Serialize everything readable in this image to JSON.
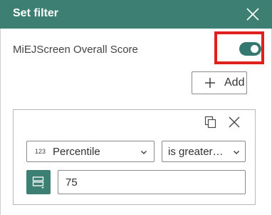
{
  "header": {
    "title": "Set filter"
  },
  "filter": {
    "field_label": "MiEJScreen Overall Score",
    "toggle_on": true,
    "highlight_color": "#e0201c"
  },
  "add_button": {
    "label": "Add"
  },
  "expression": {
    "field_type_icon_text": "123",
    "field": "Percentile",
    "operator": "is greater…",
    "value": "75"
  },
  "colors": {
    "accent": "#3e7f74",
    "toggle": "#35786f"
  }
}
